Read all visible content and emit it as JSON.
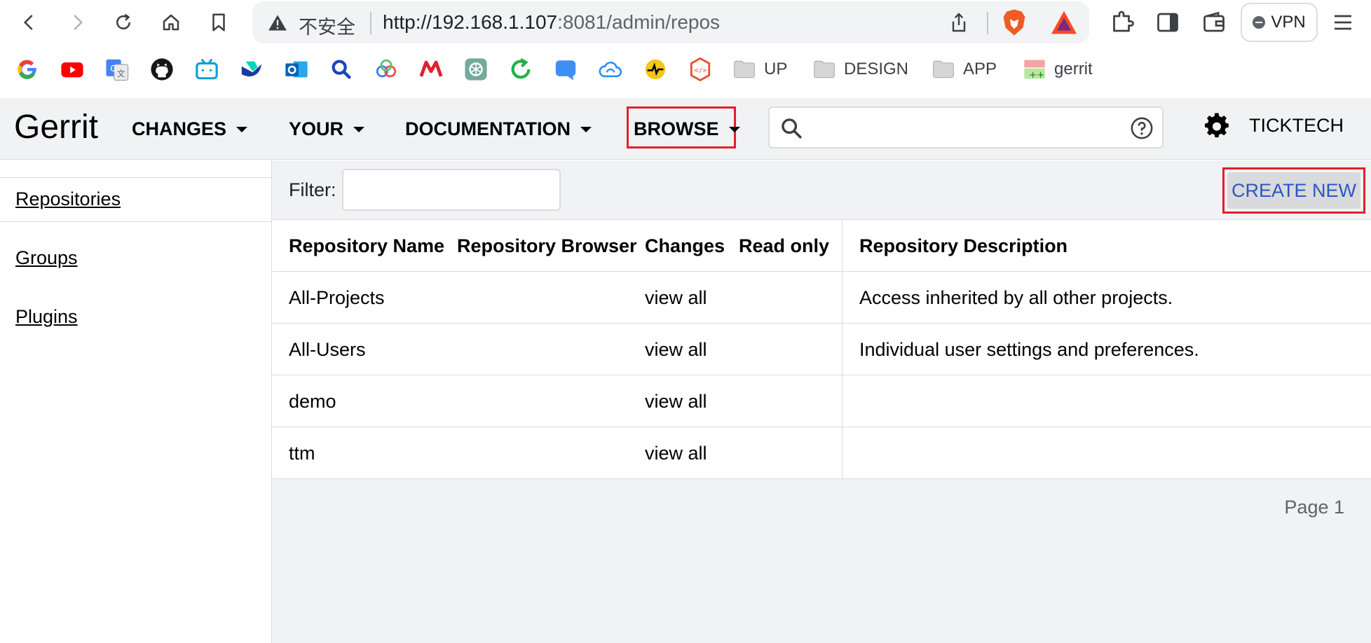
{
  "browser": {
    "insecure_label": "不安全",
    "url_host": "http://192.168.1.107",
    "url_rest": ":8081/admin/repos",
    "vpn_label": "VPN"
  },
  "bookmarks": {
    "folders": [
      {
        "label": "UP"
      },
      {
        "label": "DESIGN"
      },
      {
        "label": "APP"
      }
    ],
    "gerrit_label": "gerrit"
  },
  "header": {
    "logo": "Gerrit",
    "menus": [
      {
        "label": "CHANGES"
      },
      {
        "label": "YOUR"
      },
      {
        "label": "DOCUMENTATION"
      },
      {
        "label": "BROWSE"
      }
    ],
    "search_placeholder": "",
    "user": "TICKTECH"
  },
  "sidebar": {
    "items": [
      {
        "label": "Repositories"
      },
      {
        "label": "Groups"
      },
      {
        "label": "Plugins"
      }
    ]
  },
  "main": {
    "filter_label": "Filter:",
    "filter_value": "",
    "create_label": "CREATE NEW",
    "columns": [
      "Repository Name",
      "Repository Browser",
      "Changes",
      "Read only",
      "Repository Description"
    ],
    "rows": [
      {
        "name": "All-Projects",
        "browser": "",
        "changes": "view all",
        "readonly": "",
        "description": "Access inherited by all other projects."
      },
      {
        "name": "All-Users",
        "browser": "",
        "changes": "view all",
        "readonly": "",
        "description": "Individual user settings and preferences."
      },
      {
        "name": "demo",
        "browser": "",
        "changes": "view all",
        "readonly": "",
        "description": ""
      },
      {
        "name": "ttm",
        "browser": "",
        "changes": "view all",
        "readonly": "",
        "description": ""
      }
    ],
    "page_label": "Page 1"
  },
  "colors": {
    "highlight_red": "#e0202d",
    "link_blue": "#2a56c6",
    "header_bg": "#f1f2f3"
  }
}
